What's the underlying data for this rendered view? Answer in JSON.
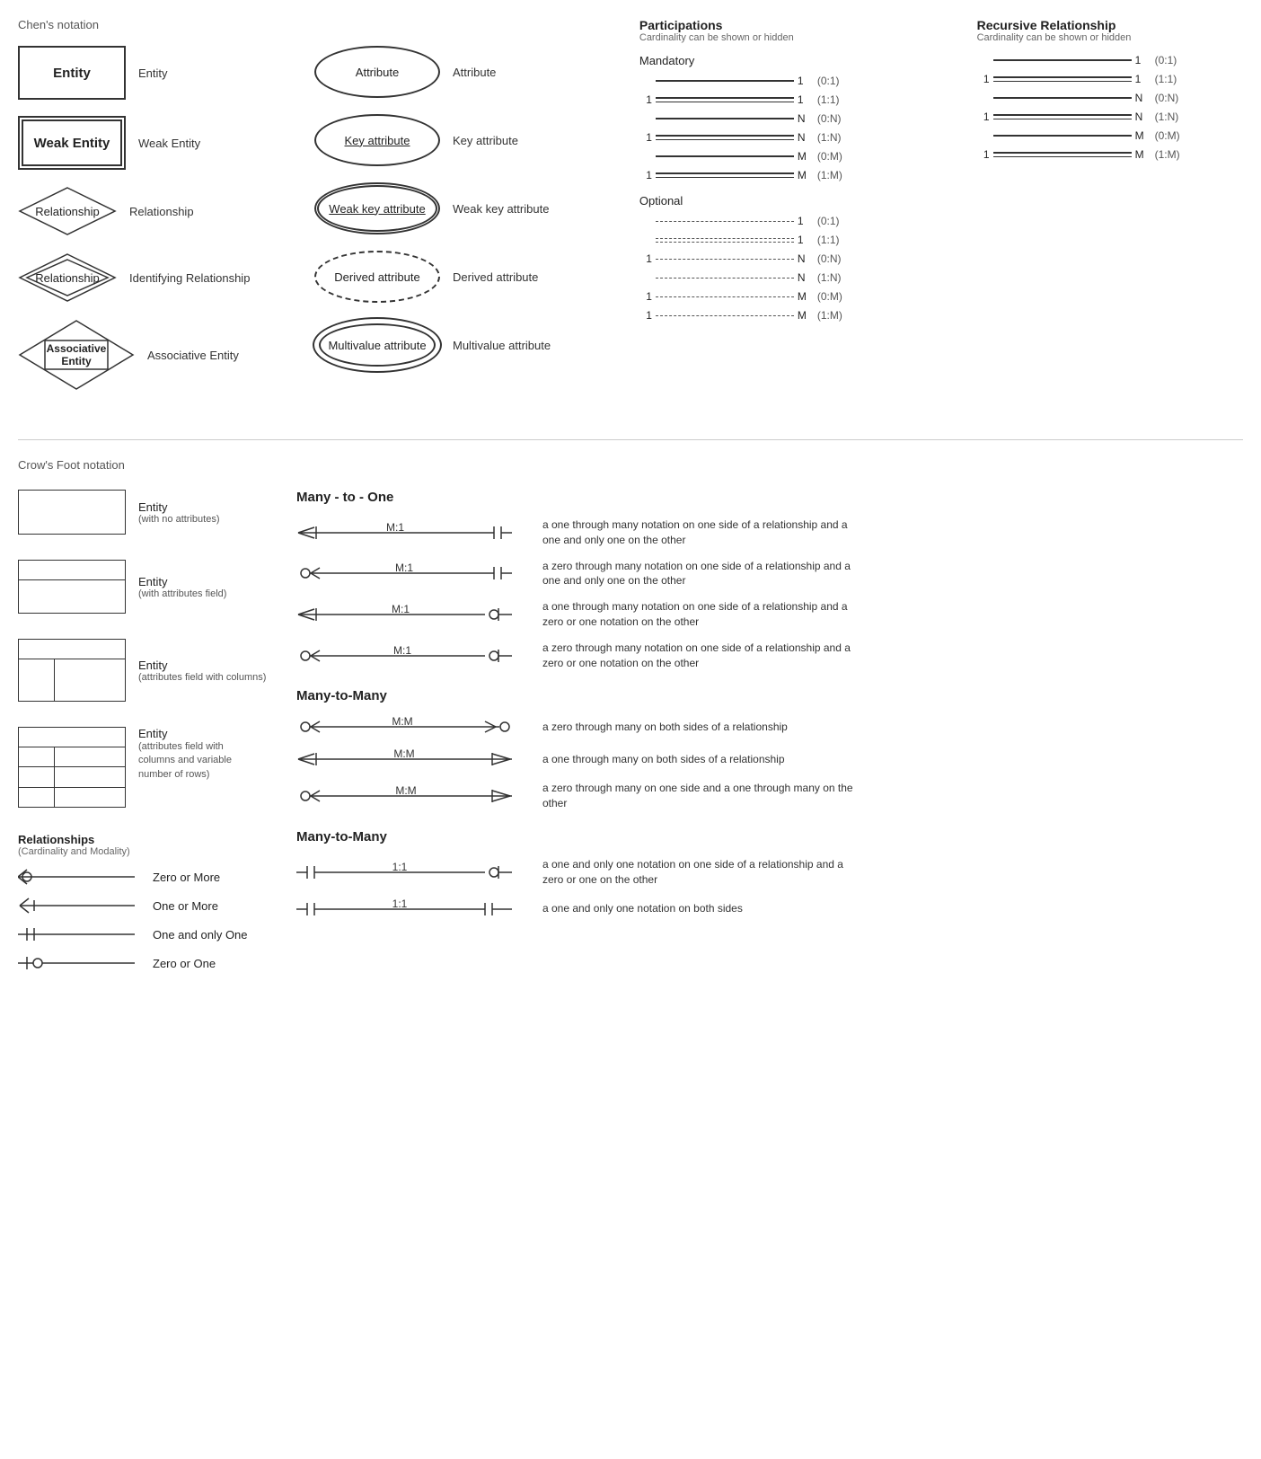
{
  "chens": {
    "title": "Chen's notation",
    "entities": [
      {
        "id": "entity",
        "label": "Entity",
        "desc": "Entity"
      },
      {
        "id": "weak-entity",
        "label": "Weak Entity",
        "desc": "Weak Entity"
      },
      {
        "id": "relationship",
        "label": "Relationship",
        "desc": "Relationship"
      },
      {
        "id": "id-relationship",
        "label": "Relationship",
        "desc": "Identifying Relationship"
      },
      {
        "id": "assoc-entity",
        "label": "Associative\nEntity",
        "desc": "Associative Entity"
      }
    ],
    "attributes": [
      {
        "id": "attribute",
        "label": "Attribute",
        "desc": "Attribute"
      },
      {
        "id": "key-attr",
        "label": "Key attribute",
        "desc": "Key attribute"
      },
      {
        "id": "weak-key-attr",
        "label": "Weak key attribute",
        "desc": "Weak key attribute"
      },
      {
        "id": "derived-attr",
        "label": "Derived attribute",
        "desc": "Derived attribute"
      },
      {
        "id": "multi-attr",
        "label": "Multivalue attribute",
        "desc": "Multivalue attribute"
      }
    ]
  },
  "participations": {
    "title": "Participations",
    "subtitle": "Cardinality can be shown or hidden",
    "mandatory": {
      "title": "Mandatory",
      "rows": [
        {
          "left": "",
          "right": "1",
          "notation": "(0:1)"
        },
        {
          "left": "1",
          "right": "1",
          "notation": "(1:1)"
        },
        {
          "left": "",
          "right": "N",
          "notation": "(0:N)"
        },
        {
          "left": "1",
          "right": "N",
          "notation": "(1:N)"
        },
        {
          "left": "",
          "right": "M",
          "notation": "(0:M)"
        },
        {
          "left": "1",
          "right": "M",
          "notation": "(1:M)"
        }
      ]
    },
    "optional": {
      "title": "Optional",
      "rows": [
        {
          "left": "",
          "right": "1",
          "notation": "(0:1)"
        },
        {
          "left": "",
          "right": "1",
          "notation": "(1:1)"
        },
        {
          "left": "1",
          "right": "N",
          "notation": "(0:N)"
        },
        {
          "left": "",
          "right": "N",
          "notation": "(1:N)"
        },
        {
          "left": "1",
          "right": "M",
          "notation": "(0:M)"
        },
        {
          "left": "1",
          "right": "M",
          "notation": "(1:M)"
        }
      ]
    }
  },
  "recursive": {
    "title": "Recursive Relationship",
    "subtitle": "Cardinality can be shown or hidden",
    "rows": [
      {
        "left": "",
        "right": "1",
        "notation": "(0:1)"
      },
      {
        "left": "1",
        "right": "1",
        "notation": "(1:1)"
      },
      {
        "left": "",
        "right": "N",
        "notation": "(0:N)"
      },
      {
        "left": "1",
        "right": "N",
        "notation": "(1:N)"
      },
      {
        "left": "",
        "right": "M",
        "notation": "(0:M)"
      },
      {
        "left": "1",
        "right": "M",
        "notation": "(1:M)"
      }
    ]
  },
  "crows": {
    "title": "Crow's Foot notation",
    "entities": [
      {
        "id": "simple",
        "desc": "Entity",
        "subdesc": "(with no attributes)"
      },
      {
        "id": "attr",
        "desc": "Entity",
        "subdesc": "(with attributes field)"
      },
      {
        "id": "cols",
        "desc": "Entity",
        "subdesc": "(attributes field with columns)"
      },
      {
        "id": "rows",
        "desc": "Entity",
        "subdesc": "(attributes field with columns and\nvariable number of rows)"
      }
    ],
    "relations_title": "Relationships",
    "relations_subtitle": "(Cardinality and Modality)",
    "relations": [
      {
        "id": "zero-more",
        "label": "Zero or More"
      },
      {
        "id": "one-more",
        "label": "One or More"
      },
      {
        "id": "one-only",
        "label": "One and only One"
      },
      {
        "id": "zero-one",
        "label": "Zero or One"
      }
    ],
    "many_to_one": {
      "title": "Many - to - One",
      "rows": [
        {
          "label": "M:1",
          "desc": "a one through many notation on one side of a relationship and a one and only one on the other"
        },
        {
          "label": "M:1",
          "desc": "a zero through many notation on one side of a relationship and a one and only one on the other"
        },
        {
          "label": "M:1",
          "desc": "a one through many notation on one side of a relationship and a zero or one notation on the other"
        },
        {
          "label": "M:1",
          "desc": "a zero through many notation on one side of a relationship and a zero or one notation on the other"
        }
      ]
    },
    "many_to_many": {
      "title": "Many-to-Many",
      "rows": [
        {
          "label": "M:M",
          "desc": "a zero through many on both sides of a relationship"
        },
        {
          "label": "M:M",
          "desc": "a one through many on both sides of a relationship"
        },
        {
          "label": "M:M",
          "desc": "a zero through many on one side and a one through many on the other"
        }
      ]
    },
    "one_to_one": {
      "title": "Many-to-Many",
      "rows": [
        {
          "label": "1:1",
          "desc": "a one and only one notation on one side of a relationship and a zero or one on the other"
        },
        {
          "label": "1:1",
          "desc": "a one and only one notation on both sides"
        }
      ]
    }
  }
}
